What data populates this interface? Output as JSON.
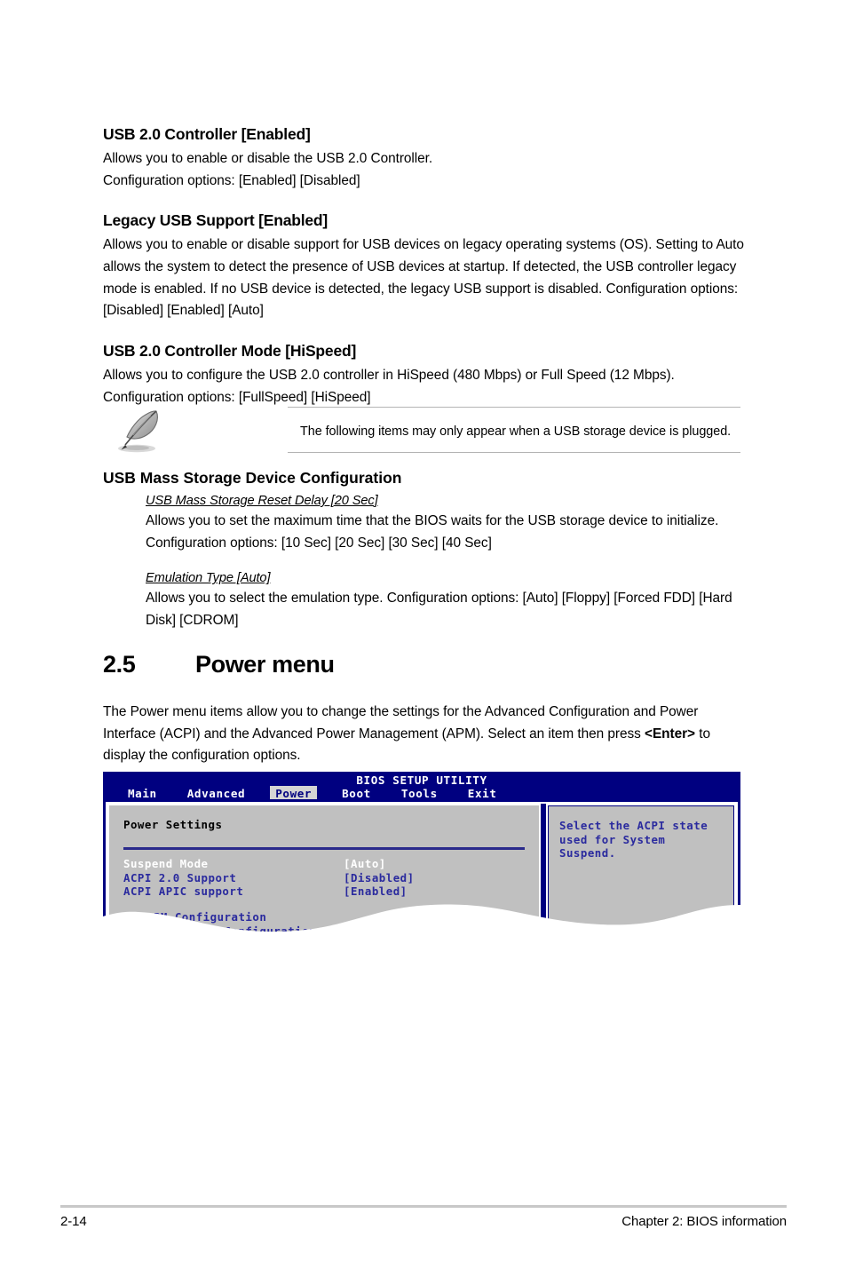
{
  "page": {
    "footer_left": "2-14",
    "footer_right": "Chapter 2: BIOS information"
  },
  "sections": {
    "usb20_controller": {
      "heading": "USB 2.0 Controller [Enabled]",
      "line1": "Allows you to enable or disable the USB 2.0 Controller.",
      "line2": "Configuration options: [Enabled] [Disabled]"
    },
    "legacy_usb": {
      "heading": "Legacy USB Support [Enabled]",
      "body": "Allows you to enable or disable support for USB devices on legacy operating systems (OS). Setting to Auto allows the system to detect the presence of USB devices at startup. If detected, the USB controller legacy mode is enabled. If no USB device is detected, the legacy USB support is disabled. Configuration options: [Disabled] [Enabled] [Auto]"
    },
    "usb20_mode": {
      "heading": "USB 2.0 Controller Mode [HiSpeed]",
      "body": "Allows you to configure the USB 2.0 controller in HiSpeed (480 Mbps) or Full Speed (12 Mbps). Configuration options: [FullSpeed] [HiSpeed]"
    },
    "note": {
      "icon": "quill-pen-icon",
      "text": "The following items may only appear when a USB storage device is plugged."
    },
    "mass_storage": {
      "heading": "USB Mass Storage Device Configuration",
      "items": [
        {
          "title": "USB Mass Storage Reset Delay [20 Sec]",
          "body": "Allows you to set the maximum time that the BIOS waits for the USB storage device to initialize. Configuration options: [10 Sec] [20 Sec] [30 Sec] [40 Sec]"
        },
        {
          "title": "Emulation Type [Auto]",
          "body": "Allows you to select the emulation type. Configuration options: [Auto] [Floppy] [Forced FDD] [Hard Disk] [CDROM]"
        }
      ]
    },
    "power_menu": {
      "number": "2.5",
      "title": "Power menu",
      "intro_part1": "The Power menu items allow you to change the settings for the Advanced Configuration and Power Interface (ACPI) and the Advanced Power Management (APM). Select an item then press ",
      "intro_key": "<Enter>",
      "intro_part2": " to display the configuration options."
    }
  },
  "bios": {
    "title": "BIOS SETUP UTILITY",
    "tabs": [
      {
        "label": "Main",
        "active": false
      },
      {
        "label": "Advanced",
        "active": false
      },
      {
        "label": "Power",
        "active": true
      },
      {
        "label": "Boot",
        "active": false
      },
      {
        "label": "Tools",
        "active": false
      },
      {
        "label": "Exit",
        "active": false
      }
    ],
    "pane_heading": "Power Settings",
    "settings": [
      {
        "label": "Suspend Mode",
        "value": "[Auto]",
        "selected": true
      },
      {
        "label": "ACPI 2.0 Support",
        "value": "[Disabled]",
        "selected": false
      },
      {
        "label": "ACPI APIC support",
        "value": "[Enabled]",
        "selected": false
      }
    ],
    "submenus": [
      {
        "arrow": "triangle-right-icon",
        "label": "APM Configuration"
      },
      {
        "arrow": "triangle-right-icon",
        "label": "HW Monitor Configuration"
      }
    ],
    "help_text": "Select the ACPI state used for System Suspend.",
    "colors": {
      "chrome": "#000080",
      "panel": "#c0c0c0",
      "text": "#2a2a9e",
      "selected_text": "#ffffff",
      "active_tab_bg": "#d4d4d4"
    }
  }
}
